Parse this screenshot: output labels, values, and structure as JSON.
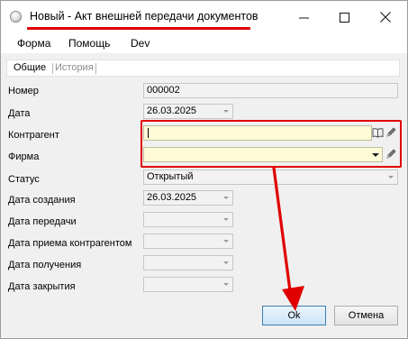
{
  "window": {
    "title": "Новый - Акт внешней передачи документов",
    "minimize_icon": "minimize-icon",
    "maximize_icon": "maximize-icon",
    "close_icon": "close-icon",
    "accent_color": "#e10000"
  },
  "menu": {
    "items": [
      {
        "label": "Форма"
      },
      {
        "label": "Помощь"
      },
      {
        "label": "Dev"
      }
    ]
  },
  "tabs": [
    {
      "label": "Общие",
      "active": true
    },
    {
      "label": "История",
      "active": false
    }
  ],
  "form": {
    "number": {
      "label": "Номер",
      "value": "000002"
    },
    "date": {
      "label": "Дата",
      "value": "26.03.2025"
    },
    "counterparty": {
      "label": "Контрагент",
      "value": "",
      "book_icon": "book-icon",
      "edit_icon": "pencil-icon"
    },
    "firm": {
      "label": "Фирма",
      "value": "",
      "edit_icon": "pencil-icon"
    },
    "status": {
      "label": "Статус",
      "value": "Открытый"
    },
    "created_date": {
      "label": "Дата создания",
      "value": "26.03.2025"
    },
    "transfer_date": {
      "label": "Дата передачи",
      "value": ""
    },
    "accept_date": {
      "label": "Дата приема контрагентом",
      "value": ""
    },
    "received_date": {
      "label": "Дата получения",
      "value": ""
    },
    "closed_date": {
      "label": "Дата закрытия",
      "value": ""
    }
  },
  "buttons": {
    "ok": "Ok",
    "cancel": "Отмена"
  }
}
